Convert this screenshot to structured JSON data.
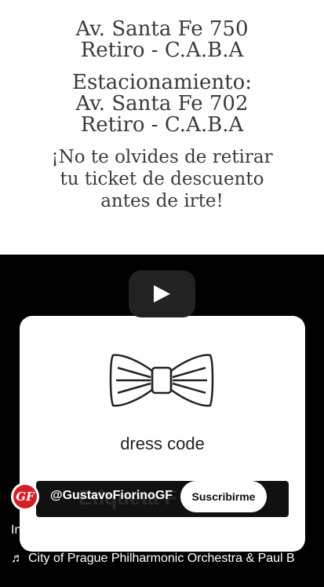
{
  "poster": {
    "address_line1": "Av. Santa Fe 750",
    "address_line2": "Retiro - C.A.B.A",
    "parking_label": "Estacionamiento:",
    "parking_line1": "Av. Santa Fe 702",
    "parking_line2": "Retiro - C.A.B.A",
    "note_line1": "¡No te olvides de retirar",
    "note_line2": "tu ticket de descuento",
    "note_line3": "antes de irte!"
  },
  "video": {
    "card_text": "dress code",
    "overlay_text": "Etiqueta F",
    "play_icon": "play-icon",
    "channel_name": "@GustavoFiorinoGF",
    "channel_avatar_text": "GF",
    "subscribe_label": "Suscribirme",
    "title": "Invitacion web",
    "music_icon": "music-note-icon",
    "music_text": "City of Prague Philharmonic Orchestra & Paul B"
  },
  "colors": {
    "accent": "#d41f26",
    "background": "#000000"
  }
}
